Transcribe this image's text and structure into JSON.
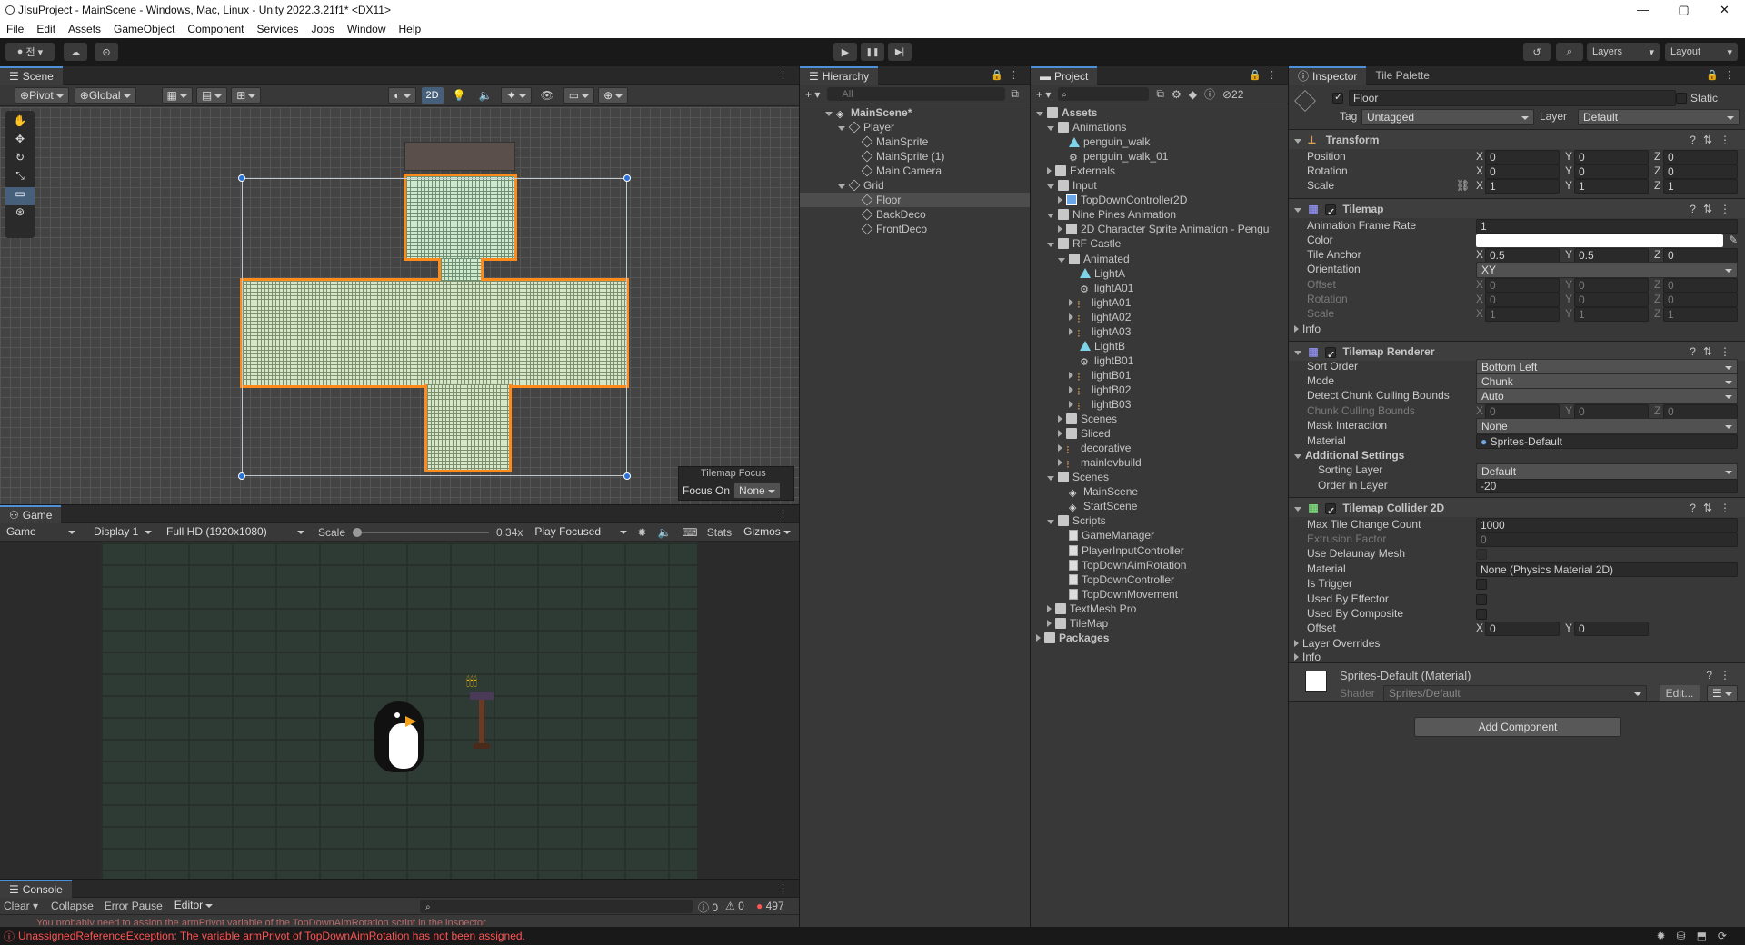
{
  "window": {
    "title": "JIsuProject - MainScene - Windows, Mac, Linux - Unity 2022.3.21f1* <DX11>",
    "min": "—",
    "max": "▢",
    "close": "✕"
  },
  "menu": [
    "File",
    "Edit",
    "Assets",
    "GameObject",
    "Component",
    "Services",
    "Jobs",
    "Window",
    "Help"
  ],
  "toolbar": {
    "account": "전",
    "layers": "Layers",
    "layout": "Layout",
    "play": "▶",
    "pause": "❚❚",
    "step": "▶|"
  },
  "scene": {
    "tab": "Scene",
    "pivot": "Pivot",
    "global": "Global",
    "twod": "2D",
    "focus_title": "Tilemap Focus",
    "focus_on": "Focus On",
    "focus_value": "None"
  },
  "game": {
    "tab": "Game",
    "mode": "Game",
    "display": "Display 1",
    "resolution": "Full HD (1920x1080)",
    "scale_label": "Scale",
    "scale_value": "0.34x",
    "play_focused": "Play Focused",
    "stats": "Stats",
    "gizmos": "Gizmos"
  },
  "console": {
    "tab": "Console",
    "clear": "Clear",
    "collapse": "Collapse",
    "error_pause": "Error Pause",
    "editor": "Editor",
    "count_info": "0",
    "count_warn": "0",
    "count_err": "497",
    "partial_msg": "You probably need to assign the armPrivot variable of the TopDownAimRotation script in the inspector",
    "status_error": "UnassignedReferenceException: The variable armPrivot of TopDownAimRotation has not been assigned."
  },
  "hierarchy": {
    "tab": "Hierarchy",
    "search_placeholder": "All",
    "items": [
      {
        "label": "MainScene*",
        "depth": 0,
        "arrow": "down",
        "icon": "scene"
      },
      {
        "label": "Player",
        "depth": 1,
        "arrow": "down",
        "icon": "cube"
      },
      {
        "label": "MainSprite",
        "depth": 2,
        "arrow": "",
        "icon": "cube"
      },
      {
        "label": "MainSprite (1)",
        "depth": 2,
        "arrow": "",
        "icon": "cube"
      },
      {
        "label": "Main Camera",
        "depth": 2,
        "arrow": "",
        "icon": "cube"
      },
      {
        "label": "Grid",
        "depth": 1,
        "arrow": "down",
        "icon": "cube"
      },
      {
        "label": "Floor",
        "depth": 2,
        "arrow": "",
        "icon": "cube"
      },
      {
        "label": "BackDeco",
        "depth": 2,
        "arrow": "",
        "icon": "cube"
      },
      {
        "label": "FrontDeco",
        "depth": 2,
        "arrow": "",
        "icon": "cube"
      }
    ]
  },
  "project": {
    "tab": "Project",
    "hidden_count": "22",
    "items": [
      {
        "label": "Assets",
        "depth": 0,
        "arrow": "down",
        "icon": "folder"
      },
      {
        "label": "Animations",
        "depth": 1,
        "arrow": "down",
        "icon": "folder"
      },
      {
        "label": "penguin_walk",
        "depth": 2,
        "arrow": "",
        "icon": "anim"
      },
      {
        "label": "penguin_walk_01",
        "depth": 2,
        "arrow": "",
        "icon": "ctrl"
      },
      {
        "label": "Externals",
        "depth": 1,
        "arrow": "right",
        "icon": "folder"
      },
      {
        "label": "Input",
        "depth": 1,
        "arrow": "down",
        "icon": "folder"
      },
      {
        "label": "TopDownController2D",
        "depth": 2,
        "arrow": "right",
        "icon": "input"
      },
      {
        "label": "Nine Pines Animation",
        "depth": 1,
        "arrow": "down",
        "icon": "folder"
      },
      {
        "label": "2D Character Sprite Animation - Pengu",
        "depth": 2,
        "arrow": "right",
        "icon": "folder"
      },
      {
        "label": "RF Castle",
        "depth": 1,
        "arrow": "down",
        "icon": "folder"
      },
      {
        "label": "Animated",
        "depth": 2,
        "arrow": "down",
        "icon": "folder"
      },
      {
        "label": "LightA",
        "depth": 3,
        "arrow": "",
        "icon": "anim"
      },
      {
        "label": "lightA01",
        "depth": 3,
        "arrow": "",
        "icon": "ctrl"
      },
      {
        "label": "lightA01",
        "depth": 3,
        "arrow": "right",
        "icon": "sprite"
      },
      {
        "label": "lightA02",
        "depth": 3,
        "arrow": "right",
        "icon": "sprite"
      },
      {
        "label": "lightA03",
        "depth": 3,
        "arrow": "right",
        "icon": "sprite"
      },
      {
        "label": "LightB",
        "depth": 3,
        "arrow": "",
        "icon": "anim"
      },
      {
        "label": "lightB01",
        "depth": 3,
        "arrow": "",
        "icon": "ctrl"
      },
      {
        "label": "lightB01",
        "depth": 3,
        "arrow": "right",
        "icon": "sprite"
      },
      {
        "label": "lightB02",
        "depth": 3,
        "arrow": "right",
        "icon": "sprite"
      },
      {
        "label": "lightB03",
        "depth": 3,
        "arrow": "right",
        "icon": "sprite"
      },
      {
        "label": "Scenes",
        "depth": 2,
        "arrow": "right",
        "icon": "folder"
      },
      {
        "label": "Sliced",
        "depth": 2,
        "arrow": "right",
        "icon": "folder"
      },
      {
        "label": "decorative",
        "depth": 2,
        "arrow": "right",
        "icon": "sprite"
      },
      {
        "label": "mainlevbuild",
        "depth": 2,
        "arrow": "right",
        "icon": "sprite"
      },
      {
        "label": "Scenes",
        "depth": 1,
        "arrow": "down",
        "icon": "folder"
      },
      {
        "label": "MainScene",
        "depth": 2,
        "arrow": "",
        "icon": "scene"
      },
      {
        "label": "StartScene",
        "depth": 2,
        "arrow": "",
        "icon": "scene"
      },
      {
        "label": "Scripts",
        "depth": 1,
        "arrow": "down",
        "icon": "folder"
      },
      {
        "label": "GameManager",
        "depth": 2,
        "arrow": "",
        "icon": "script"
      },
      {
        "label": "PlayerInputController",
        "depth": 2,
        "arrow": "",
        "icon": "script"
      },
      {
        "label": "TopDownAimRotation",
        "depth": 2,
        "arrow": "",
        "icon": "script"
      },
      {
        "label": "TopDownController",
        "depth": 2,
        "arrow": "",
        "icon": "script"
      },
      {
        "label": "TopDownMovement",
        "depth": 2,
        "arrow": "",
        "icon": "script"
      },
      {
        "label": "TextMesh Pro",
        "depth": 1,
        "arrow": "right",
        "icon": "folder"
      },
      {
        "label": "TileMap",
        "depth": 1,
        "arrow": "right",
        "icon": "folder"
      },
      {
        "label": "Packages",
        "depth": 0,
        "arrow": "right",
        "icon": "folder"
      }
    ]
  },
  "inspector": {
    "tab": "Inspector",
    "tab2": "Tile Palette",
    "object_name": "Floor",
    "static_label": "Static",
    "tag_label": "Tag",
    "tag_value": "Untagged",
    "layer_label": "Layer",
    "layer_value": "Default",
    "transform": {
      "title": "Transform",
      "position": "Position",
      "rotation": "Rotation",
      "scale": "Scale",
      "pos": [
        "0",
        "0",
        "0"
      ],
      "rot": [
        "0",
        "0",
        "0"
      ],
      "scl": [
        "1",
        "1",
        "1"
      ]
    },
    "tilemap": {
      "title": "Tilemap",
      "frame_rate_label": "Animation Frame Rate",
      "frame_rate": "1",
      "color_label": "Color",
      "anchor_label": "Tile Anchor",
      "anchor": [
        "0.5",
        "0.5",
        "0"
      ],
      "orientation_label": "Orientation",
      "orientation": "XY",
      "offset_label": "Offset",
      "offset": [
        "0",
        "0",
        "0"
      ],
      "rotation_label": "Rotation",
      "rotation": [
        "0",
        "0",
        "0"
      ],
      "scale_label": "Scale",
      "scale": [
        "1",
        "1",
        "1"
      ],
      "info": "Info"
    },
    "renderer": {
      "title": "Tilemap Renderer",
      "sort_order_label": "Sort Order",
      "sort_order": "Bottom Left",
      "mode_label": "Mode",
      "mode": "Chunk",
      "culling_label": "Detect Chunk Culling Bounds",
      "culling": "Auto",
      "bounds_label": "Chunk Culling Bounds",
      "bounds": [
        "0",
        "0",
        "0"
      ],
      "mask_label": "Mask Interaction",
      "mask": "None",
      "material_label": "Material",
      "material": "Sprites-Default",
      "additional": "Additional Settings",
      "sorting_layer_label": "Sorting Layer",
      "sorting_layer": "Default",
      "order_label": "Order in Layer",
      "order": "-20"
    },
    "collider": {
      "title": "Tilemap Collider 2D",
      "max_label": "Max Tile Change Count",
      "max": "1000",
      "extrusion_label": "Extrusion Factor",
      "extrusion": "0",
      "delaunay_label": "Use Delaunay Mesh",
      "material_label": "Material",
      "material": "None (Physics Material 2D)",
      "trigger_label": "Is Trigger",
      "effector_label": "Used By Effector",
      "composite_label": "Used By Composite",
      "offset_label": "Offset",
      "offset": [
        "0",
        "0"
      ],
      "overrides": "Layer Overrides",
      "info": "Info"
    },
    "material": {
      "name": "Sprites-Default (Material)",
      "shader_label": "Shader",
      "shader": "Sprites/Default",
      "edit": "Edit..."
    },
    "add_component": "Add Component"
  },
  "axes": {
    "x": "X",
    "y": "Y",
    "z": "Z"
  },
  "colors": {
    "accent": "#4d90d8",
    "selection": "#2c5d87",
    "error": "#ff5454",
    "tile_border": "#ff8a1c"
  }
}
